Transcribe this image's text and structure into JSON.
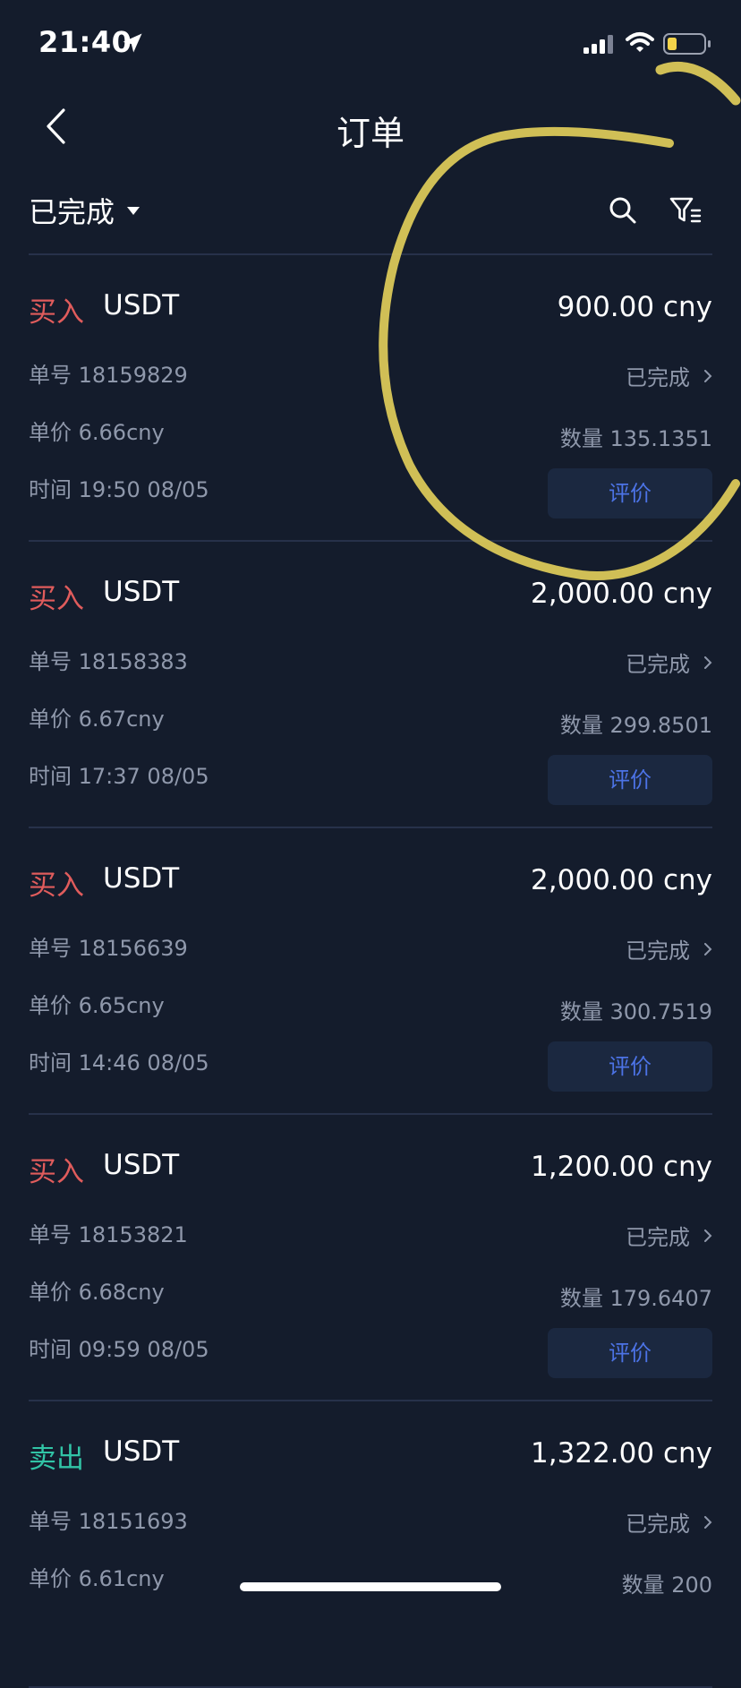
{
  "status_bar": {
    "time": "21:40",
    "icons": [
      "location-arrow-icon",
      "cellular-signal-icon",
      "wifi-icon",
      "battery-low-icon"
    ],
    "battery_color": "#f3d34a"
  },
  "nav": {
    "back_icon": "chevron-left-icon",
    "title": "订单"
  },
  "filter": {
    "status_label": "已完成",
    "icons": [
      "search-icon",
      "filter-icon"
    ]
  },
  "colors": {
    "background": "#141c2c",
    "buy": "#e05c5c",
    "sell": "#31c4a6",
    "accent": "#4c73e6",
    "button_bg": "#1b2840",
    "annotation": "#e4d15b"
  },
  "orders": [
    {
      "side": "买入",
      "side_type": "buy",
      "asset": "USDT",
      "amount": "900.00 cny",
      "order_no": "单号 18159829",
      "unit_price": "单价 6.66cny",
      "time": "时间 19:50 08/05",
      "status": "已完成",
      "quantity": "数量 135.1351",
      "review_label": "评价"
    },
    {
      "side": "买入",
      "side_type": "buy",
      "asset": "USDT",
      "amount": "2,000.00 cny",
      "order_no": "单号 18158383",
      "unit_price": "单价 6.67cny",
      "time": "时间 17:37 08/05",
      "status": "已完成",
      "quantity": "数量 299.8501",
      "review_label": "评价"
    },
    {
      "side": "买入",
      "side_type": "buy",
      "asset": "USDT",
      "amount": "2,000.00 cny",
      "order_no": "单号 18156639",
      "unit_price": "单价 6.65cny",
      "time": "时间 14:46 08/05",
      "status": "已完成",
      "quantity": "数量 300.7519",
      "review_label": "评价"
    },
    {
      "side": "买入",
      "side_type": "buy",
      "asset": "USDT",
      "amount": "1,200.00 cny",
      "order_no": "单号 18153821",
      "unit_price": "单价 6.68cny",
      "time": "时间 09:59 08/05",
      "status": "已完成",
      "quantity": "数量 179.6407",
      "review_label": "评价"
    },
    {
      "side": "卖出",
      "side_type": "sell",
      "asset": "USDT",
      "amount": "1,322.00 cny",
      "order_no": "单号 18151693",
      "unit_price": "单价 6.61cny",
      "status": "已完成",
      "quantity": "数量 200"
    }
  ]
}
